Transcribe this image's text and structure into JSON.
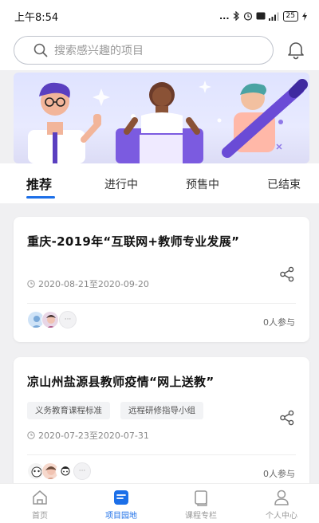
{
  "status_bar": {
    "time": "上午8:54",
    "dots": "...",
    "battery": "25"
  },
  "search": {
    "placeholder": "搜索感兴趣的项目"
  },
  "tabs": [
    {
      "label": "推荐",
      "active": true
    },
    {
      "label": "进行中",
      "active": false
    },
    {
      "label": "预售中",
      "active": false
    },
    {
      "label": "已结束",
      "active": false
    }
  ],
  "cards": [
    {
      "title": "重庆-2019年“互联网+教师专业发展”",
      "tags": [],
      "date": "2020-08-21至2020-09-20",
      "join": "0人参与"
    },
    {
      "title": "凉山州盐源县教师疫情“网上送教”",
      "tags": [
        "义务教育课程标准",
        "远程研修指导小组"
      ],
      "date": "2020-07-23至2020-07-31",
      "join": "0人参与"
    }
  ],
  "more_label": "···",
  "bottom_nav": [
    {
      "label": "首页",
      "icon": "home-icon",
      "active": false
    },
    {
      "label": "项目园地",
      "icon": "project-icon",
      "active": true
    },
    {
      "label": "课程专栏",
      "icon": "course-icon",
      "active": false
    },
    {
      "label": "个人中心",
      "icon": "person-icon",
      "active": false
    }
  ],
  "colors": {
    "accent": "#1c6fe8",
    "background": "#f0f0f2",
    "banner": "#e3e5ff"
  }
}
